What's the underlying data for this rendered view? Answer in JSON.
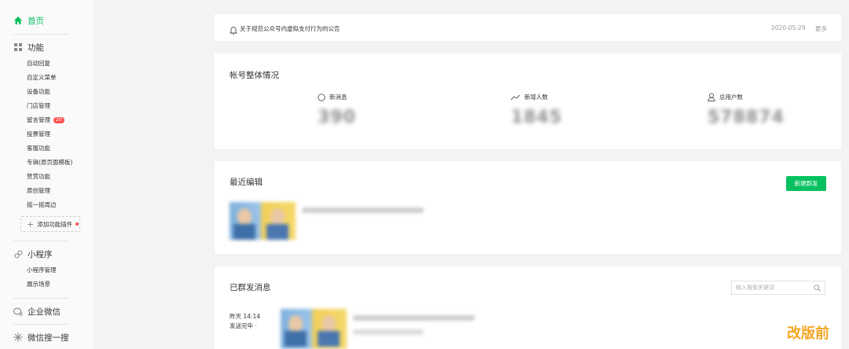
{
  "sidebar": {
    "home": "首页",
    "features": "功能",
    "feature_items": [
      "自动回复",
      "自定义菜单",
      "设备功能",
      "门店管理",
      "留言管理",
      "投票管理",
      "客服功能",
      "专辑(原页面模板)",
      "赞赏功能",
      "原创管理",
      "摇一摇周边"
    ],
    "comment_badge": "20",
    "add_plugin": "添加功能插件",
    "mini_program": "小程序",
    "mini_items": [
      "小程序管理",
      "展示场景"
    ],
    "wecom": "企业微信",
    "search": "微信搜一搜"
  },
  "notice": {
    "text": "关于规范公众号内虚拟支付行为的公告",
    "date": "2020-05-29",
    "more": "更多"
  },
  "overview": {
    "title": "帐号整体情况",
    "stats": [
      {
        "label": "新消息",
        "value": "390"
      },
      {
        "label": "新增人数",
        "value": "1845"
      },
      {
        "label": "总用户数",
        "value": "578874"
      }
    ]
  },
  "recent": {
    "title": "最近编辑",
    "new_button": "新建群发"
  },
  "sent": {
    "title": "已群发消息",
    "search_placeholder": "输入搜索关键词",
    "time": "昨天 14:14",
    "status": "发送完毕 ·"
  },
  "watermark": "改版前",
  "colors": {
    "accent": "#07c160",
    "badge": "#fa5151",
    "watermark": "#f5a623"
  }
}
